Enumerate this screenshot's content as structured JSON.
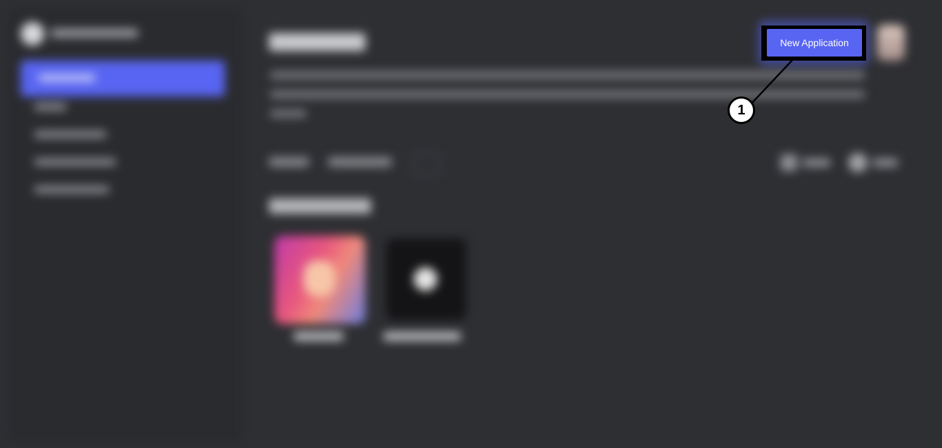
{
  "header": {
    "new_application_button_label": "New Application"
  },
  "annotation": {
    "step_number": "1"
  },
  "colors": {
    "accent": "#5865f2",
    "background": "#2e2f33",
    "sidebar": "#2a2b2f",
    "annotation": "#000000"
  }
}
